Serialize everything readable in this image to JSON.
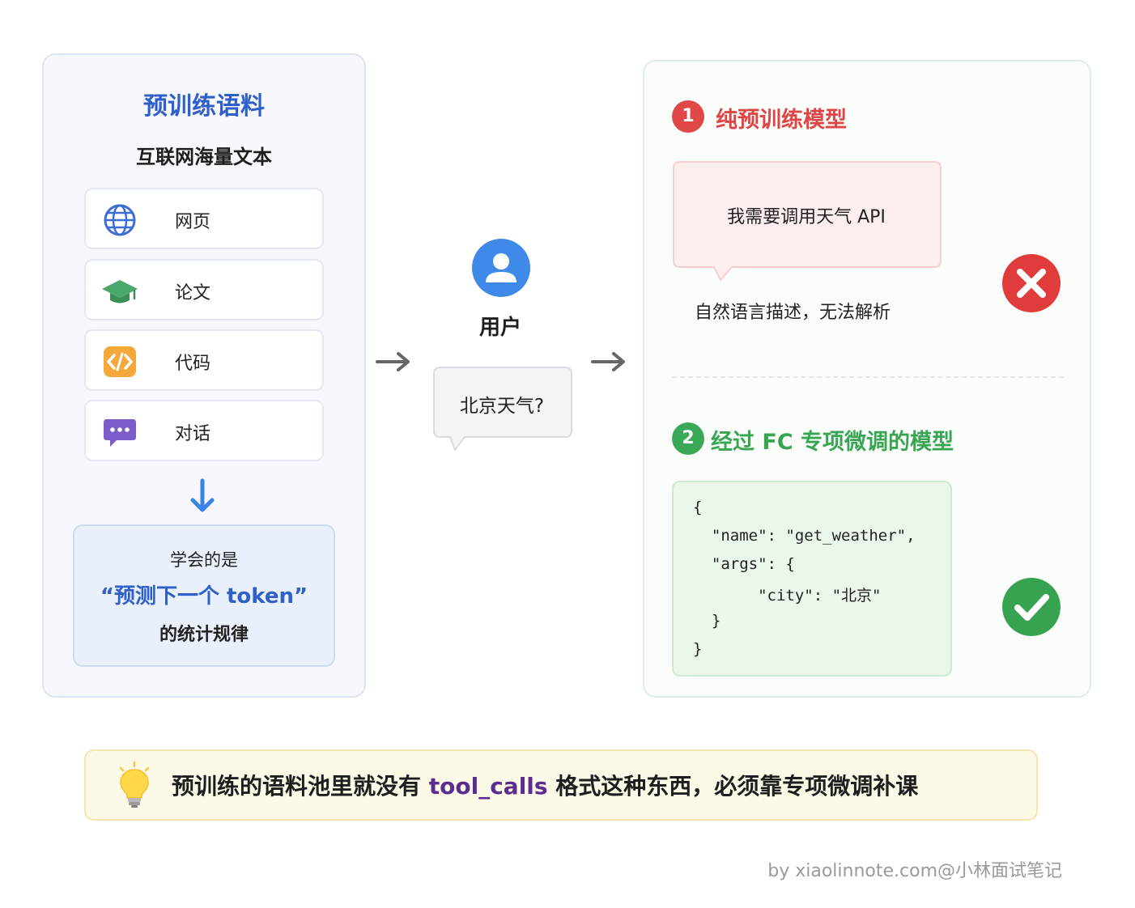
{
  "left": {
    "title": "预训练语料",
    "subtitle": "互联网海量文本",
    "sources": [
      {
        "label": "网页",
        "icon": "globe-icon"
      },
      {
        "label": "论文",
        "icon": "graduation-cap-icon"
      },
      {
        "label": "代码",
        "icon": "code-icon"
      },
      {
        "label": "对话",
        "icon": "chat-icon"
      }
    ],
    "learn": {
      "line1": "学会的是",
      "line2": "“预测下一个 token”",
      "line3": "的统计规律"
    }
  },
  "middle": {
    "user_label": "用户",
    "user_query": "北京天气?"
  },
  "right": {
    "section1": {
      "number": "1",
      "title": "纯预训练模型",
      "bubble": "我需要调用天气 API",
      "note": "自然语言描述，无法解析",
      "status_icon": "x-icon"
    },
    "section2": {
      "number": "2",
      "title": "经过 FC 专项微调的模型",
      "code_lines": [
        "{",
        "  \"name\": \"get_weather\",",
        "  \"args\": {",
        "       \"city\": \"北京\"",
        "  }",
        "}"
      ],
      "status_icon": "check-icon"
    }
  },
  "tip": {
    "before": "预训练的语料池里就没有 ",
    "code": "tool_calls",
    "after": " 格式这种东西，必须靠专项微调补课"
  },
  "watermark": "by xiaolinnote.com@小林面试笔记",
  "colors": {
    "blue": "#2f5fc8",
    "red": "#e04848",
    "green": "#3aa957",
    "purple": "#5b2d8e"
  }
}
